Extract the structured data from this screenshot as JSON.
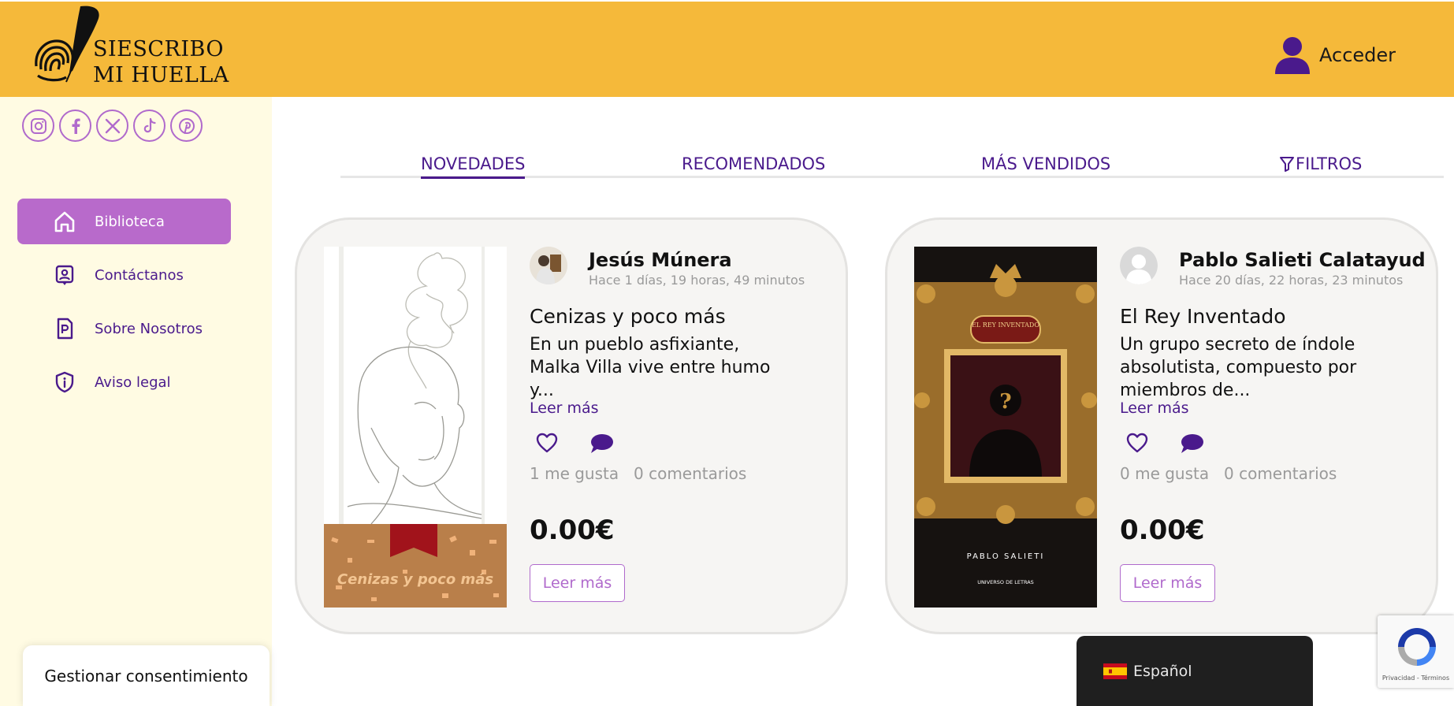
{
  "brand": {
    "line1": "SIESCRIBO",
    "line2": "MI HUELLA"
  },
  "header": {
    "login_label": "Acceder"
  },
  "socials": [
    "instagram-icon",
    "facebook-icon",
    "x-icon",
    "tiktok-icon",
    "pinterest-icon"
  ],
  "sidebar": {
    "items": [
      {
        "label": "Biblioteca",
        "icon": "home-icon",
        "active": true
      },
      {
        "label": "Contáctanos",
        "icon": "contact-icon",
        "active": false
      },
      {
        "label": "Sobre Nosotros",
        "icon": "document-icon",
        "active": false
      },
      {
        "label": "Aviso legal",
        "icon": "shield-icon",
        "active": false
      }
    ]
  },
  "tabs": [
    {
      "label": "NOVEDADES",
      "active": true
    },
    {
      "label": "RECOMENDADOS",
      "active": false
    },
    {
      "label": "MÁS VENDIDOS",
      "active": false
    },
    {
      "label": "FILTROS",
      "active": false
    }
  ],
  "books": [
    {
      "author": "Jesús Múnera",
      "time": "Hace 1 días, 19 horas, 49 minutos",
      "title": "Cenizas y poco más",
      "description": "En un pueblo asfixiante, Malka Villa vive entre humo y...",
      "read_more": "Leer más",
      "likes": "1 me gusta",
      "comments": "0 comentarios",
      "price": "0.00€",
      "button": "Leer más",
      "cover_text": "Cenizas y poco más"
    },
    {
      "author": "Pablo Salieti Calatayud",
      "time": "Hace 20 días, 22 horas, 23 minutos",
      "title": "El Rey Inventado",
      "description": "Un grupo secreto de índole absolutista, compuesto por miembros de...",
      "read_more": "Leer más",
      "likes": "0 me gusta",
      "comments": "0 comentarios",
      "price": "0.00€",
      "button": "Leer más",
      "cover_title": "EL REY INVENTADO",
      "cover_author": "PABLO SALIETI",
      "cover_publisher": "UNIVERSO DE LETRAS"
    }
  ],
  "consent": {
    "label": "Gestionar consentimiento"
  },
  "language": {
    "label": "Español"
  },
  "recaptcha": {
    "text": "Privacidad - Términos"
  },
  "colors": {
    "header": "#f5b93a",
    "accent": "#b86acb",
    "primary": "#4a1a8c",
    "sidebar": "#fffbe3"
  }
}
